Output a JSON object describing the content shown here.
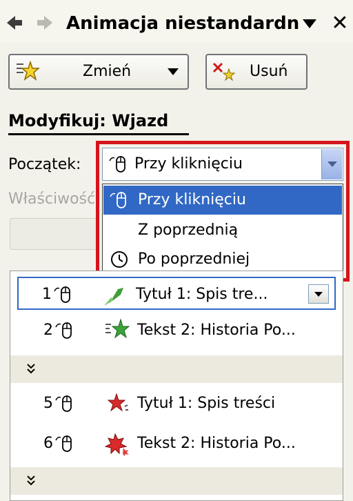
{
  "panel": {
    "title": "Animacja niestandardn",
    "close_glyph": "✕"
  },
  "toolbar": {
    "change_label": "Zmień",
    "remove_label": "Usuń"
  },
  "modify": {
    "heading": "Modyfikuj: Wjazd",
    "start_label": "Początek:",
    "properties_label": "Właściwość"
  },
  "start_dropdown": {
    "selected": "Przy kliknięciu",
    "options": [
      {
        "label": "Przy kliknięciu",
        "icon": "mouse-icon",
        "highlighted": true
      },
      {
        "label": "Z poprzednią",
        "icon": "",
        "highlighted": false
      },
      {
        "label": "Po poprzedniej",
        "icon": "clock-icon",
        "highlighted": false
      }
    ]
  },
  "animation_list": {
    "rows": [
      {
        "num": "1",
        "text": "Tytuł 1: Spis tre...",
        "selected": true
      },
      {
        "num": "2",
        "text": "Tekst 2: Historia Po...",
        "selected": false
      },
      {
        "num": "5",
        "text": "Tytuł 1: Spis treści",
        "selected": false
      },
      {
        "num": "6",
        "text": "Tekst 2: Historia Po...",
        "selected": false
      }
    ],
    "collapse_glyph": "expand-chevron"
  },
  "colors": {
    "highlight_border": "#d6141c",
    "selection": "#3168c5"
  }
}
